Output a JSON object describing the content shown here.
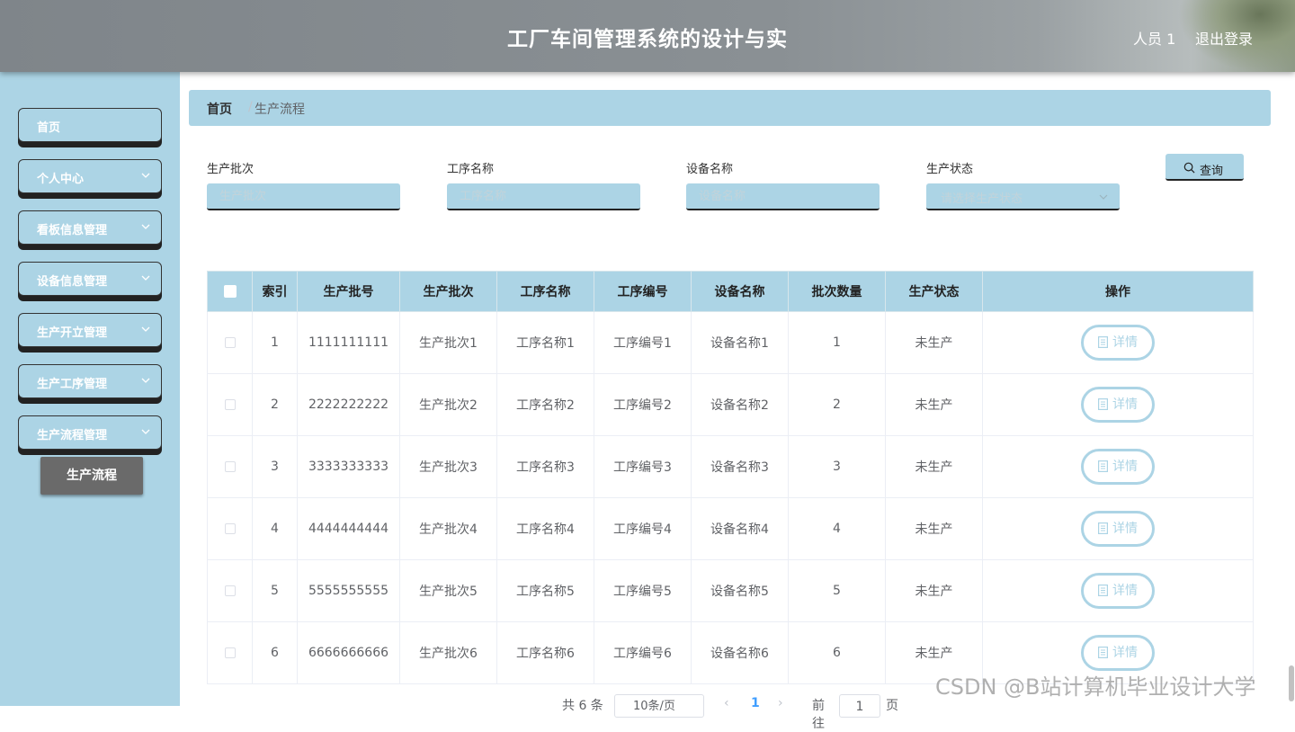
{
  "header": {
    "title": "工厂车间管理系统的设计与实",
    "user": "人员 1",
    "logout": "退出登录"
  },
  "sidebar": {
    "items": [
      {
        "label": "首页",
        "has_submenu": false
      },
      {
        "label": "个人中心",
        "has_submenu": true
      },
      {
        "label": "看板信息管理",
        "has_submenu": true
      },
      {
        "label": "设备信息管理",
        "has_submenu": true
      },
      {
        "label": "生产开立管理",
        "has_submenu": true
      },
      {
        "label": "生产工序管理",
        "has_submenu": true
      },
      {
        "label": "生产流程管理",
        "has_submenu": true
      }
    ],
    "active_sub": "生产流程"
  },
  "breadcrumb": {
    "home": "首页",
    "separator": "/",
    "current": "生产流程"
  },
  "search": {
    "batch_label": "生产批次",
    "batch_placeholder": "生产批次",
    "process_label": "工序名称",
    "process_placeholder": "工序名称",
    "device_label": "设备名称",
    "device_placeholder": "设备名称",
    "status_label": "生产状态",
    "status_placeholder": "请选择生产状态",
    "query_button": "查询"
  },
  "table": {
    "headers": [
      "索引",
      "生产批号",
      "生产批次",
      "工序名称",
      "工序编号",
      "设备名称",
      "批次数量",
      "生产状态",
      "操作"
    ],
    "detail_label": "详情",
    "rows": [
      {
        "index": "1",
        "batch_no": "1111111111",
        "batch": "生产批次1",
        "process_name": "工序名称1",
        "process_no": "工序编号1",
        "device": "设备名称1",
        "qty": "1",
        "status": "未生产"
      },
      {
        "index": "2",
        "batch_no": "2222222222",
        "batch": "生产批次2",
        "process_name": "工序名称2",
        "process_no": "工序编号2",
        "device": "设备名称2",
        "qty": "2",
        "status": "未生产"
      },
      {
        "index": "3",
        "batch_no": "3333333333",
        "batch": "生产批次3",
        "process_name": "工序名称3",
        "process_no": "工序编号3",
        "device": "设备名称3",
        "qty": "3",
        "status": "未生产"
      },
      {
        "index": "4",
        "batch_no": "4444444444",
        "batch": "生产批次4",
        "process_name": "工序名称4",
        "process_no": "工序编号4",
        "device": "设备名称4",
        "qty": "4",
        "status": "未生产"
      },
      {
        "index": "5",
        "batch_no": "5555555555",
        "batch": "生产批次5",
        "process_name": "工序名称5",
        "process_no": "工序编号5",
        "device": "设备名称5",
        "qty": "5",
        "status": "未生产"
      },
      {
        "index": "6",
        "batch_no": "6666666666",
        "batch": "生产批次6",
        "process_name": "工序名称6",
        "process_no": "工序编号6",
        "device": "设备名称6",
        "qty": "6",
        "status": "未生产"
      }
    ]
  },
  "pagination": {
    "total": "共 6 条",
    "page_size": "10条/页",
    "prev": "‹",
    "current_page": "1",
    "next": "›",
    "goto": "前往",
    "jump_value": "1",
    "page_unit": "页"
  },
  "watermark": "CSDN @B站计算机毕业设计大学",
  "colors": {
    "accent": "#acd4e5",
    "submenu_active": "#6a6a6a",
    "header": "#868c90"
  },
  "icons": {
    "chevron": "chevron-down-icon",
    "search": "search-icon",
    "detail": "document-icon"
  }
}
